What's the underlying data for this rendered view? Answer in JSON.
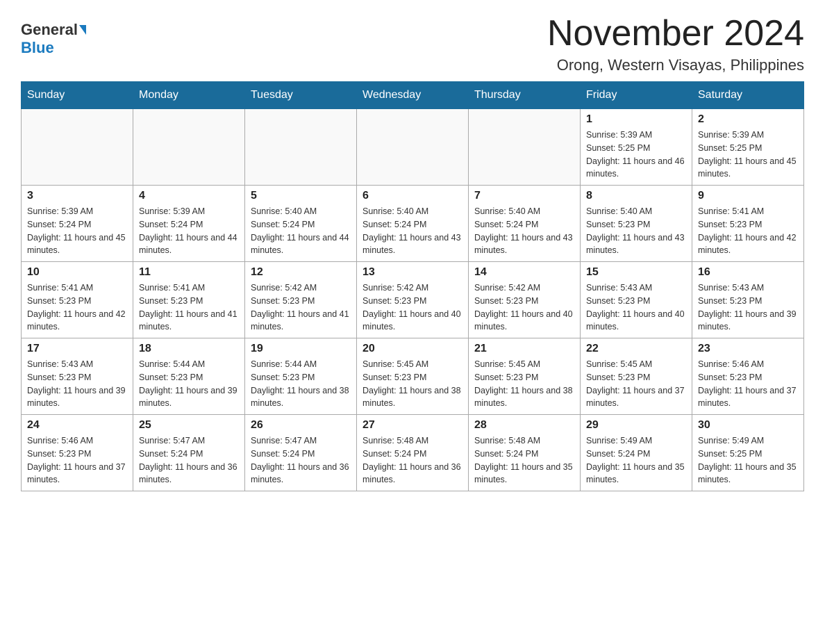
{
  "logo": {
    "general": "General",
    "blue": "Blue"
  },
  "title": "November 2024",
  "location": "Orong, Western Visayas, Philippines",
  "days_of_week": [
    "Sunday",
    "Monday",
    "Tuesday",
    "Wednesday",
    "Thursday",
    "Friday",
    "Saturday"
  ],
  "weeks": [
    [
      {
        "day": "",
        "info": ""
      },
      {
        "day": "",
        "info": ""
      },
      {
        "day": "",
        "info": ""
      },
      {
        "day": "",
        "info": ""
      },
      {
        "day": "",
        "info": ""
      },
      {
        "day": "1",
        "info": "Sunrise: 5:39 AM\nSunset: 5:25 PM\nDaylight: 11 hours and 46 minutes."
      },
      {
        "day": "2",
        "info": "Sunrise: 5:39 AM\nSunset: 5:25 PM\nDaylight: 11 hours and 45 minutes."
      }
    ],
    [
      {
        "day": "3",
        "info": "Sunrise: 5:39 AM\nSunset: 5:24 PM\nDaylight: 11 hours and 45 minutes."
      },
      {
        "day": "4",
        "info": "Sunrise: 5:39 AM\nSunset: 5:24 PM\nDaylight: 11 hours and 44 minutes."
      },
      {
        "day": "5",
        "info": "Sunrise: 5:40 AM\nSunset: 5:24 PM\nDaylight: 11 hours and 44 minutes."
      },
      {
        "day": "6",
        "info": "Sunrise: 5:40 AM\nSunset: 5:24 PM\nDaylight: 11 hours and 43 minutes."
      },
      {
        "day": "7",
        "info": "Sunrise: 5:40 AM\nSunset: 5:24 PM\nDaylight: 11 hours and 43 minutes."
      },
      {
        "day": "8",
        "info": "Sunrise: 5:40 AM\nSunset: 5:23 PM\nDaylight: 11 hours and 43 minutes."
      },
      {
        "day": "9",
        "info": "Sunrise: 5:41 AM\nSunset: 5:23 PM\nDaylight: 11 hours and 42 minutes."
      }
    ],
    [
      {
        "day": "10",
        "info": "Sunrise: 5:41 AM\nSunset: 5:23 PM\nDaylight: 11 hours and 42 minutes."
      },
      {
        "day": "11",
        "info": "Sunrise: 5:41 AM\nSunset: 5:23 PM\nDaylight: 11 hours and 41 minutes."
      },
      {
        "day": "12",
        "info": "Sunrise: 5:42 AM\nSunset: 5:23 PM\nDaylight: 11 hours and 41 minutes."
      },
      {
        "day": "13",
        "info": "Sunrise: 5:42 AM\nSunset: 5:23 PM\nDaylight: 11 hours and 40 minutes."
      },
      {
        "day": "14",
        "info": "Sunrise: 5:42 AM\nSunset: 5:23 PM\nDaylight: 11 hours and 40 minutes."
      },
      {
        "day": "15",
        "info": "Sunrise: 5:43 AM\nSunset: 5:23 PM\nDaylight: 11 hours and 40 minutes."
      },
      {
        "day": "16",
        "info": "Sunrise: 5:43 AM\nSunset: 5:23 PM\nDaylight: 11 hours and 39 minutes."
      }
    ],
    [
      {
        "day": "17",
        "info": "Sunrise: 5:43 AM\nSunset: 5:23 PM\nDaylight: 11 hours and 39 minutes."
      },
      {
        "day": "18",
        "info": "Sunrise: 5:44 AM\nSunset: 5:23 PM\nDaylight: 11 hours and 39 minutes."
      },
      {
        "day": "19",
        "info": "Sunrise: 5:44 AM\nSunset: 5:23 PM\nDaylight: 11 hours and 38 minutes."
      },
      {
        "day": "20",
        "info": "Sunrise: 5:45 AM\nSunset: 5:23 PM\nDaylight: 11 hours and 38 minutes."
      },
      {
        "day": "21",
        "info": "Sunrise: 5:45 AM\nSunset: 5:23 PM\nDaylight: 11 hours and 38 minutes."
      },
      {
        "day": "22",
        "info": "Sunrise: 5:45 AM\nSunset: 5:23 PM\nDaylight: 11 hours and 37 minutes."
      },
      {
        "day": "23",
        "info": "Sunrise: 5:46 AM\nSunset: 5:23 PM\nDaylight: 11 hours and 37 minutes."
      }
    ],
    [
      {
        "day": "24",
        "info": "Sunrise: 5:46 AM\nSunset: 5:23 PM\nDaylight: 11 hours and 37 minutes."
      },
      {
        "day": "25",
        "info": "Sunrise: 5:47 AM\nSunset: 5:24 PM\nDaylight: 11 hours and 36 minutes."
      },
      {
        "day": "26",
        "info": "Sunrise: 5:47 AM\nSunset: 5:24 PM\nDaylight: 11 hours and 36 minutes."
      },
      {
        "day": "27",
        "info": "Sunrise: 5:48 AM\nSunset: 5:24 PM\nDaylight: 11 hours and 36 minutes."
      },
      {
        "day": "28",
        "info": "Sunrise: 5:48 AM\nSunset: 5:24 PM\nDaylight: 11 hours and 35 minutes."
      },
      {
        "day": "29",
        "info": "Sunrise: 5:49 AM\nSunset: 5:24 PM\nDaylight: 11 hours and 35 minutes."
      },
      {
        "day": "30",
        "info": "Sunrise: 5:49 AM\nSunset: 5:25 PM\nDaylight: 11 hours and 35 minutes."
      }
    ]
  ]
}
